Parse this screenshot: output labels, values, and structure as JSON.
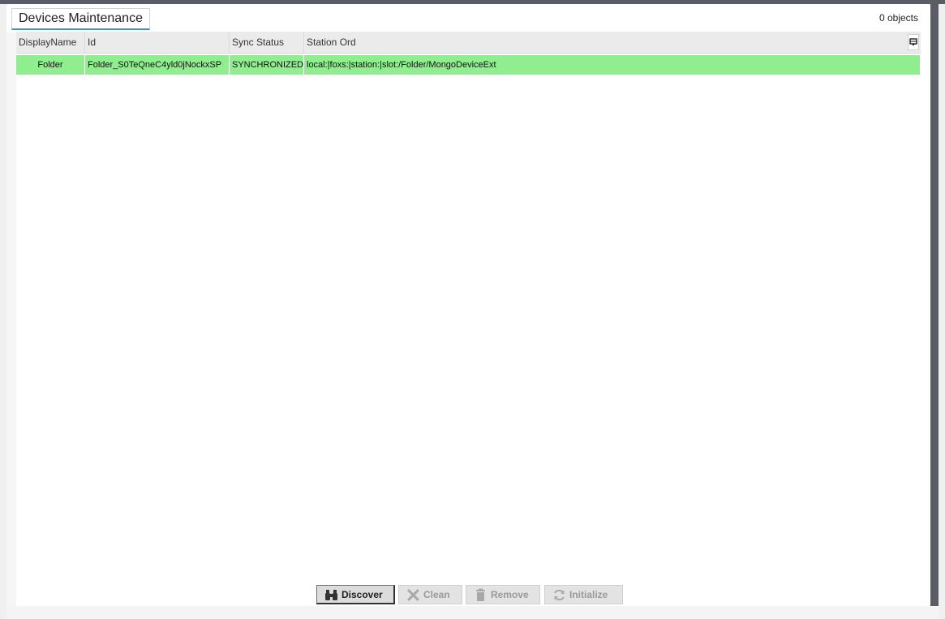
{
  "header": {
    "title": "Devices Maintenance",
    "object_count": "0 objects"
  },
  "table": {
    "columns": [
      {
        "key": "display_name",
        "label": "DisplayName"
      },
      {
        "key": "id",
        "label": "Id"
      },
      {
        "key": "sync_status",
        "label": "Sync Status"
      },
      {
        "key": "station_ord",
        "label": "Station Ord"
      }
    ],
    "column_menu_icon": "column-chooser-icon",
    "rows": [
      {
        "display_name": "Folder",
        "id": "Folder_S0TeQneC4yld0jNockxSP",
        "sync_status": "SYNCHRONIZED",
        "station_ord": "local:|foxs:|station:|slot:/Folder/MongoDeviceExt",
        "highlight_color": "#90ee90"
      }
    ]
  },
  "toolbar": {
    "discover": {
      "label": "Discover",
      "icon": "binoculars-icon",
      "enabled": true
    },
    "clean": {
      "label": "Clean",
      "icon": "x-icon",
      "enabled": false
    },
    "remove": {
      "label": "Remove",
      "icon": "trash-icon",
      "enabled": false
    },
    "initialize": {
      "label": "Initialize",
      "icon": "refresh-icon",
      "enabled": false
    }
  },
  "colors": {
    "accent_underline": "#4a90c8",
    "row_highlight": "#90ee90",
    "frame": "#5a5d63"
  }
}
